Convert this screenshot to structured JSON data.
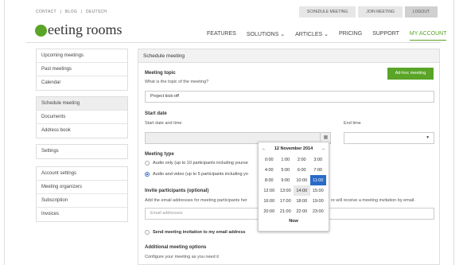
{
  "header": {
    "top_links": [
      "CONTACT",
      "|",
      "BLOG",
      "|",
      "DEUTSCH"
    ],
    "buttons": {
      "schedule": "SCHEDULE MEETING",
      "join": "JOIN MEETING",
      "logout": "LOGOUT"
    },
    "logo_text": "eeting rooms",
    "nav": [
      "FEATURES",
      "SOLUTIONS ⌄",
      "ARTICLES ⌄",
      "PRICING",
      "SUPPORT",
      "MY ACCOUNT"
    ]
  },
  "sidebar": {
    "group1": [
      "Upcoming meetings",
      "Past meetings",
      "Calendar"
    ],
    "group2": [
      "Schedule meeting",
      "Documents",
      "Address book"
    ],
    "group3": [
      "Settings"
    ],
    "group4": [
      "Account settings",
      "Meeting organizers",
      "Subscription",
      "Invoices"
    ]
  },
  "form": {
    "title": "Schedule meeting",
    "adhoc": "Ad-hoc meeting",
    "topic_label": "Meeting topic",
    "topic_help": "What is the topic of the meeting?",
    "topic_value": "Project kick-off",
    "start_label": "Start date",
    "start_help": "Start date and time",
    "end_help": "End time",
    "type_label": "Meeting type",
    "type_audio": "Audio only (up to 10 participants including yourse",
    "type_video": "Audio and video (up to 5 participants including yo",
    "invite_label": "Invite participants (optional)",
    "invite_help": "Add the email addresses for meeting participants her",
    "invite_help_right": "re will receive a meeting invitation by email.",
    "email_placeholder": "Email addresses",
    "send_label": "Send meeting invitation to my email address",
    "additional_label": "Additional meeting options",
    "additional_help": "Configure your meeting as you need it",
    "calendar_glyph": "▦",
    "dropdown_glyph": "▾"
  },
  "picker": {
    "prev": "←",
    "next": "→",
    "date": "12 November 2014",
    "times": [
      [
        "0:00",
        "1:00",
        "2:00",
        "3:00"
      ],
      [
        "4:00",
        "5:00",
        "6:00",
        "7:00"
      ],
      [
        "8:00",
        "9:00",
        "10:00",
        "11:00"
      ],
      [
        "12:00",
        "13:00",
        "14:00",
        "15:00"
      ],
      [
        "16:00",
        "17:00",
        "18:00",
        "19:00"
      ],
      [
        "20:00",
        "21:00",
        "22:00",
        "23:00"
      ]
    ],
    "selected": "11:00",
    "hovered": "14:00",
    "now": "Now"
  },
  "colors": {
    "accent": "#5aa528",
    "selected": "#2a6bc7"
  }
}
